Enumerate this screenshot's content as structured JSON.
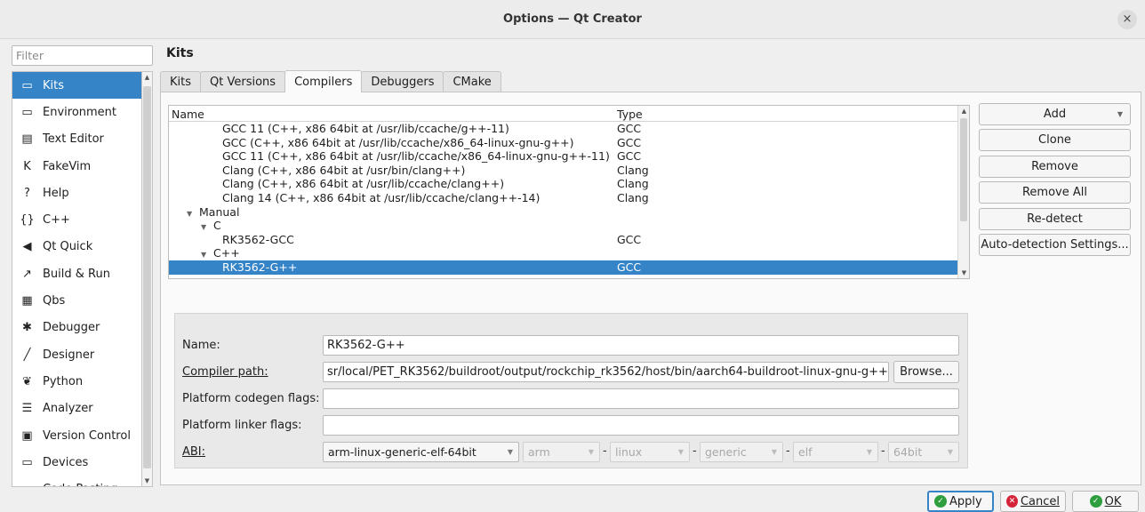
{
  "window": {
    "title": "Options — Qt Creator",
    "close_label": "×"
  },
  "filter": {
    "placeholder": "Filter"
  },
  "nav": {
    "items": [
      {
        "label": "Kits",
        "icon": "kits-icon",
        "glyph": "▭"
      },
      {
        "label": "Environment",
        "icon": "monitor-icon",
        "glyph": "▭"
      },
      {
        "label": "Text Editor",
        "icon": "text-editor-icon",
        "glyph": "▤"
      },
      {
        "label": "FakeVim",
        "icon": "fakevim-icon",
        "glyph": "K"
      },
      {
        "label": "Help",
        "icon": "help-icon",
        "glyph": "?"
      },
      {
        "label": "C++",
        "icon": "braces-icon",
        "glyph": "{}"
      },
      {
        "label": "Qt Quick",
        "icon": "qt-quick-icon",
        "glyph": "◀"
      },
      {
        "label": "Build & Run",
        "icon": "hammer-icon",
        "glyph": "↗"
      },
      {
        "label": "Qbs",
        "icon": "qbs-icon",
        "glyph": "▦"
      },
      {
        "label": "Debugger",
        "icon": "bug-icon",
        "glyph": "✱"
      },
      {
        "label": "Designer",
        "icon": "pencil-icon",
        "glyph": "╱"
      },
      {
        "label": "Python",
        "icon": "python-icon",
        "glyph": "❦"
      },
      {
        "label": "Analyzer",
        "icon": "analyzer-icon",
        "glyph": "☰"
      },
      {
        "label": "Version Control",
        "icon": "version-control-icon",
        "glyph": "▣"
      },
      {
        "label": "Devices",
        "icon": "devices-icon",
        "glyph": "▭"
      },
      {
        "label": "Code Pasting",
        "icon": "paste-icon",
        "glyph": "▭"
      }
    ]
  },
  "page": {
    "title": "Kits"
  },
  "tabs": [
    "Kits",
    "Qt Versions",
    "Compilers",
    "Debuggers",
    "CMake"
  ],
  "tree": {
    "headers": {
      "name": "Name",
      "type": "Type"
    },
    "rows": [
      {
        "name": "GCC 11 (C++, x86 64bit at /usr/lib/ccache/g++-11)",
        "type": "GCC"
      },
      {
        "name": "GCC (C++, x86 64bit at /usr/lib/ccache/x86_64-linux-gnu-g++)",
        "type": "GCC"
      },
      {
        "name": "GCC 11 (C++, x86 64bit at /usr/lib/ccache/x86_64-linux-gnu-g++-11)",
        "type": "GCC"
      },
      {
        "name": "Clang (C++, x86 64bit at /usr/bin/clang++)",
        "type": "Clang"
      },
      {
        "name": "Clang (C++, x86 64bit at /usr/lib/ccache/clang++)",
        "type": "Clang"
      },
      {
        "name": "Clang 14 (C++, x86 64bit at /usr/lib/ccache/clang++-14)",
        "type": "Clang"
      },
      {
        "name": "Manual",
        "type": ""
      },
      {
        "name": "C",
        "type": ""
      },
      {
        "name": "RK3562-GCC",
        "type": "GCC"
      },
      {
        "name": "C++",
        "type": ""
      },
      {
        "name": "RK3562-G++",
        "type": "GCC"
      }
    ]
  },
  "buttons": {
    "add": "Add",
    "clone": "Clone",
    "remove": "Remove",
    "remove_all": "Remove All",
    "redetect": "Re-detect",
    "auto_detection": "Auto-detection Settings..."
  },
  "details": {
    "name_label": "Name:",
    "name_value": "RK3562-G++",
    "compiler_path_label": "Compiler path:",
    "compiler_path_value": "sr/local/PET_RK3562/buildroot/output/rockchip_rk3562/host/bin/aarch64-buildroot-linux-gnu-g++",
    "browse": "Browse...",
    "codegen_label": "Platform codegen flags:",
    "codegen_value": "",
    "linker_label": "Platform linker flags:",
    "linker_value": "",
    "abi_label": "ABI:",
    "abi": {
      "main": "arm-linux-generic-elf-64bit",
      "arch": "arm",
      "os": "linux",
      "flavor": "generic",
      "format": "elf",
      "width": "64bit"
    },
    "dash": "-"
  },
  "footer": {
    "apply": "Apply",
    "cancel": "Cancel",
    "ok": "OK"
  },
  "colors": {
    "accent": "#3584c8",
    "apply_icon": "#2e9e3e",
    "cancel_icon": "#d4243a"
  }
}
